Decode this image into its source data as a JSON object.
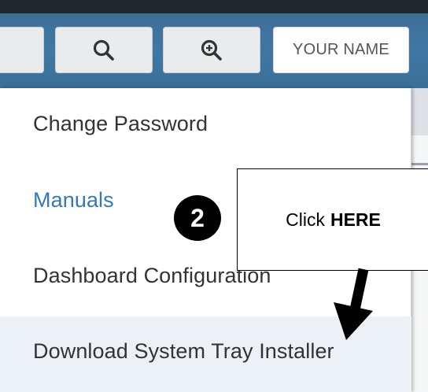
{
  "toolbar": {
    "user_label": "YOUR NAME",
    "icons": [
      "search-icon",
      "zoom-in-icon"
    ]
  },
  "menu": {
    "items": [
      {
        "label": "Change Password"
      },
      {
        "label": "Manuals",
        "color": "#3479b7"
      },
      {
        "label": "Dashboard Configuration"
      },
      {
        "label": "Download System Tray Installer",
        "highlight": "#ecf0f7"
      }
    ]
  },
  "annotation": {
    "step": "2",
    "callout_prefix": "Click",
    "callout_emphasis": "HERE"
  },
  "colors": {
    "toolbar_bg": "#3f77a3",
    "top_strip": "#22272d",
    "link": "#3479b7"
  }
}
